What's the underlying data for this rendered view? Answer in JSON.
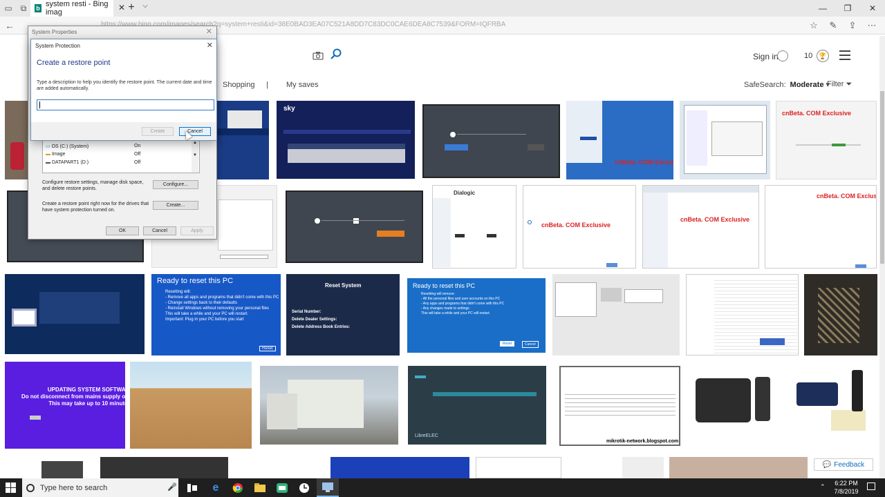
{
  "browser": {
    "tab_title": "system resti - Bing imag",
    "url": "https://www.bing.com/images/search?q=system+resti&id=38E0BAD3EA07C521A8DD7C83DC0CAE6DEA8C7539&FORM=IQFRBA",
    "new_tab": "+"
  },
  "header": {
    "sign_in": "Sign in",
    "rewards_count": "10"
  },
  "nav": {
    "shopping": "Shopping",
    "separator": "|",
    "my_saves": "My saves",
    "safesearch_label": "SafeSearch:",
    "safesearch_value": "Moderate",
    "filter": "Filter"
  },
  "system_properties": {
    "title": "System Properties",
    "drives": [
      {
        "name": "OS (C:) (System)",
        "protection": "On"
      },
      {
        "name": "Image",
        "protection": "Off"
      },
      {
        "name": "DATAPART1 (D:)",
        "protection": "Off"
      }
    ],
    "configure_text": "Configure restore settings, manage disk space, and delete restore points.",
    "configure_button": "Configure...",
    "create_text": "Create a restore point right now for the drives that have system protection turned on.",
    "create_button": "Create...",
    "ok": "OK",
    "cancel": "Cancel",
    "apply": "Apply"
  },
  "system_protection": {
    "title": "System Protection",
    "heading": "Create a restore point",
    "description": "Type a description to help you identify the restore point. The current date and time are added automatically.",
    "input_value": "",
    "create_button": "Create",
    "cancel_button": "Cancel"
  },
  "thumbnails": {
    "t_ready1_title": "Ready to reset this PC",
    "t_ready1_body": "Resetting will:\n- Remove all apps and programs that didn't come with this PC\n- Change settings back to their defaults\n- Reinstall Windows without removing your personal files\nThis will take a while and your PC will restart.\nImportant: Plug in your PC before you start",
    "t_ready1_btn": "Reset",
    "t_resetsys_title": "Reset System",
    "t_resetsys_body": "Serial Number:\nDelete Dealer Settings:\nDelete Address Book Entries:",
    "t_ready2_title": "Ready to reset this PC",
    "t_ready2_body": "Resetting will remove:\n- All the personal files and user accounts on this PC\n- Any apps and programs that didn't come with this PC\n- Any changes made to settings\nThis will take a while and your PC will restart.",
    "t_ready2_btn1": "Reset",
    "t_ready2_btn2": "Cancel",
    "cnbeta1": "cnBeta. COM Exclusive",
    "cnbeta2": "cnBeta. COM Exclusive",
    "cnbeta3": "cnBeta. COM Exclusive",
    "cnbeta4": "cnBeta. COM Exclusive",
    "cnbeta5": "cnBeta. COM Exclusive",
    "updating": "UPDATING SYSTEM SOFTWARE\nDo not disconnect from mains supply or signal feed.\nThis may take up to 10 minutes.",
    "mikrotik": "mikrotik-network.blogspot.com",
    "libreelec": "LibreELEC",
    "sky": "sky",
    "dialogic": "Dialogic"
  },
  "feedback": "Feedback",
  "taskbar": {
    "search_placeholder": "Type here to search",
    "time": "6:22 PM",
    "date": "7/8/2019"
  }
}
